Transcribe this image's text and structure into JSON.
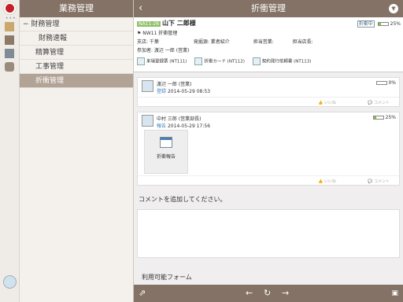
{
  "sidebar": {
    "title": "業務管理",
    "items": [
      {
        "label": "財務管理",
        "level": 0,
        "prefix": "−"
      },
      {
        "label": "財務速報",
        "level": 1
      },
      {
        "label": "精算管理",
        "level": 1
      },
      {
        "label": "工事管理",
        "level": 1
      },
      {
        "label": "折衝管理",
        "level": 1,
        "selected": true
      }
    ]
  },
  "main": {
    "title": "折衝管理",
    "header": {
      "code": "NA11-26",
      "customer": "山下 二郎様",
      "type_label": "NW11 折衝管理",
      "fields": [
        "支店: 千葉",
        "発掘源: 業者紹介",
        "担当営業:",
        "担当店長:"
      ],
      "participant": "参加者: 渡辺 一郎 (営業)",
      "status_tag": "折衝中",
      "progress": "25%",
      "docs": [
        {
          "label": "来場登録票 (NT111)"
        },
        {
          "label": "折衝カード (NT112)"
        },
        {
          "label": "契約発行依頼書 (NT113)"
        }
      ]
    },
    "posts": [
      {
        "author": "渡辺 一郎 (営業)",
        "action": "登録",
        "date": "2014-05-29 08:53",
        "progress": "0%",
        "like": "いいね",
        "comment": "コメント"
      },
      {
        "author": "中村 三郎 (営業部長)",
        "action": "報告",
        "date": "2014-05-29 17:56",
        "progress": "25%",
        "attachment": "折衝報告",
        "like": "いいね",
        "comment": "コメント"
      }
    ],
    "comment_prompt": "コメントを追加してください。",
    "forms_title": "利用可能フォーム"
  },
  "colors": {
    "bar": "#837265",
    "accent": "#8fc06a",
    "link": "#3d7fbf"
  }
}
